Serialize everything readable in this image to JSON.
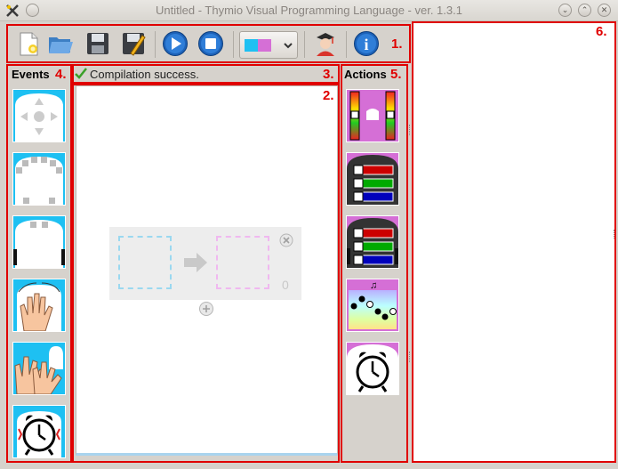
{
  "window": {
    "title": "Untitled - Thymio Visual Programming Language - ver. 1.3.1"
  },
  "status": {
    "message": "Compilation success."
  },
  "panels": {
    "events_title": "Events",
    "actions_title": "Actions"
  },
  "toolbar": {
    "buttons": [
      "new-file",
      "open-file",
      "save-file",
      "save-as",
      "run",
      "stop",
      "color-scheme",
      "advanced-mode",
      "help"
    ]
  },
  "event_set": {
    "count": "0"
  },
  "annotations": [
    "1.",
    "2.",
    "3.",
    "4.",
    "5.",
    "6."
  ],
  "colors": {
    "accent_cyan": "#0aaee8",
    "event_blue": "#1ec0f2",
    "action_pink": "#d56fd6",
    "annotation_red": "#e00000"
  }
}
